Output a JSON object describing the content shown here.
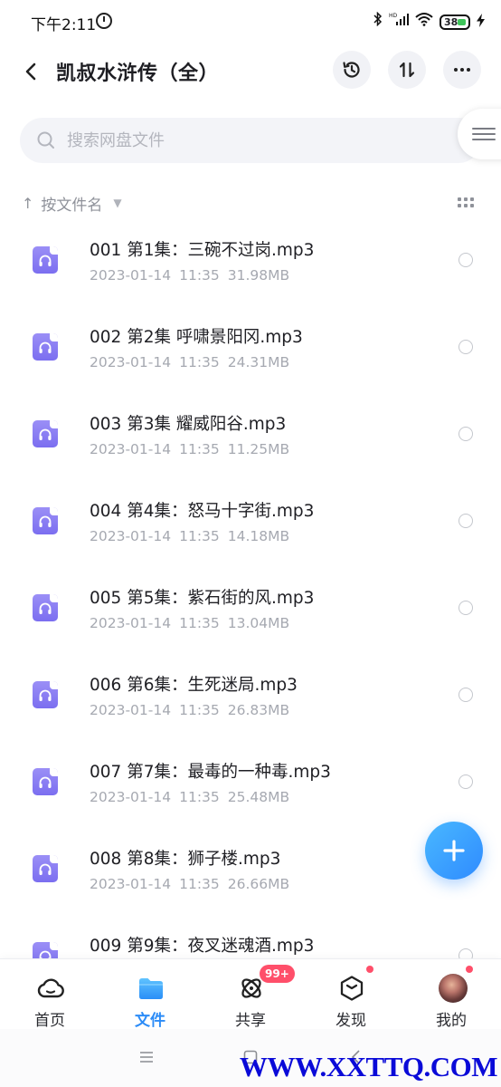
{
  "status_bar": {
    "time": "下午2:11",
    "battery": "38"
  },
  "header": {
    "title": "凯叔水浒传（全）"
  },
  "search": {
    "placeholder": "搜索网盘文件"
  },
  "sort": {
    "label": "按文件名"
  },
  "files": [
    {
      "name": "001 第1集：三碗不过岗.mp3",
      "date": "2023-01-14",
      "time": "11:35",
      "size": "31.98MB"
    },
    {
      "name": "002 第2集 呼啸景阳冈.mp3",
      "date": "2023-01-14",
      "time": "11:35",
      "size": "24.31MB"
    },
    {
      "name": "003 第3集 耀威阳谷.mp3",
      "date": "2023-01-14",
      "time": "11:35",
      "size": "11.25MB"
    },
    {
      "name": "004 第4集：怒马十字街.mp3",
      "date": "2023-01-14",
      "time": "11:35",
      "size": "14.18MB"
    },
    {
      "name": "005 第5集：紫石街的风.mp3",
      "date": "2023-01-14",
      "time": "11:35",
      "size": "13.04MB"
    },
    {
      "name": "006 第6集：生死迷局.mp3",
      "date": "2023-01-14",
      "time": "11:35",
      "size": "26.83MB"
    },
    {
      "name": "007 第7集：最毒的一种毒.mp3",
      "date": "2023-01-14",
      "time": "11:35",
      "size": "25.48MB"
    },
    {
      "name": "008 第8集：狮子楼.mp3",
      "date": "2023-01-14",
      "time": "11:35",
      "size": "26.66MB"
    },
    {
      "name": "009 第9集：夜叉迷魂酒.mp3",
      "date": "",
      "time": "",
      "size": ""
    }
  ],
  "nav": {
    "items": [
      {
        "label": "首页"
      },
      {
        "label": "文件"
      },
      {
        "label": "共享"
      },
      {
        "label": "发现"
      },
      {
        "label": "我的"
      }
    ],
    "share_badge": "99+"
  },
  "watermark": "WWW.XXTTQ.COM",
  "colors": {
    "accent": "#2c8cf7",
    "file_icon": "#8a7ef4",
    "badge": "#ff4f6a"
  }
}
